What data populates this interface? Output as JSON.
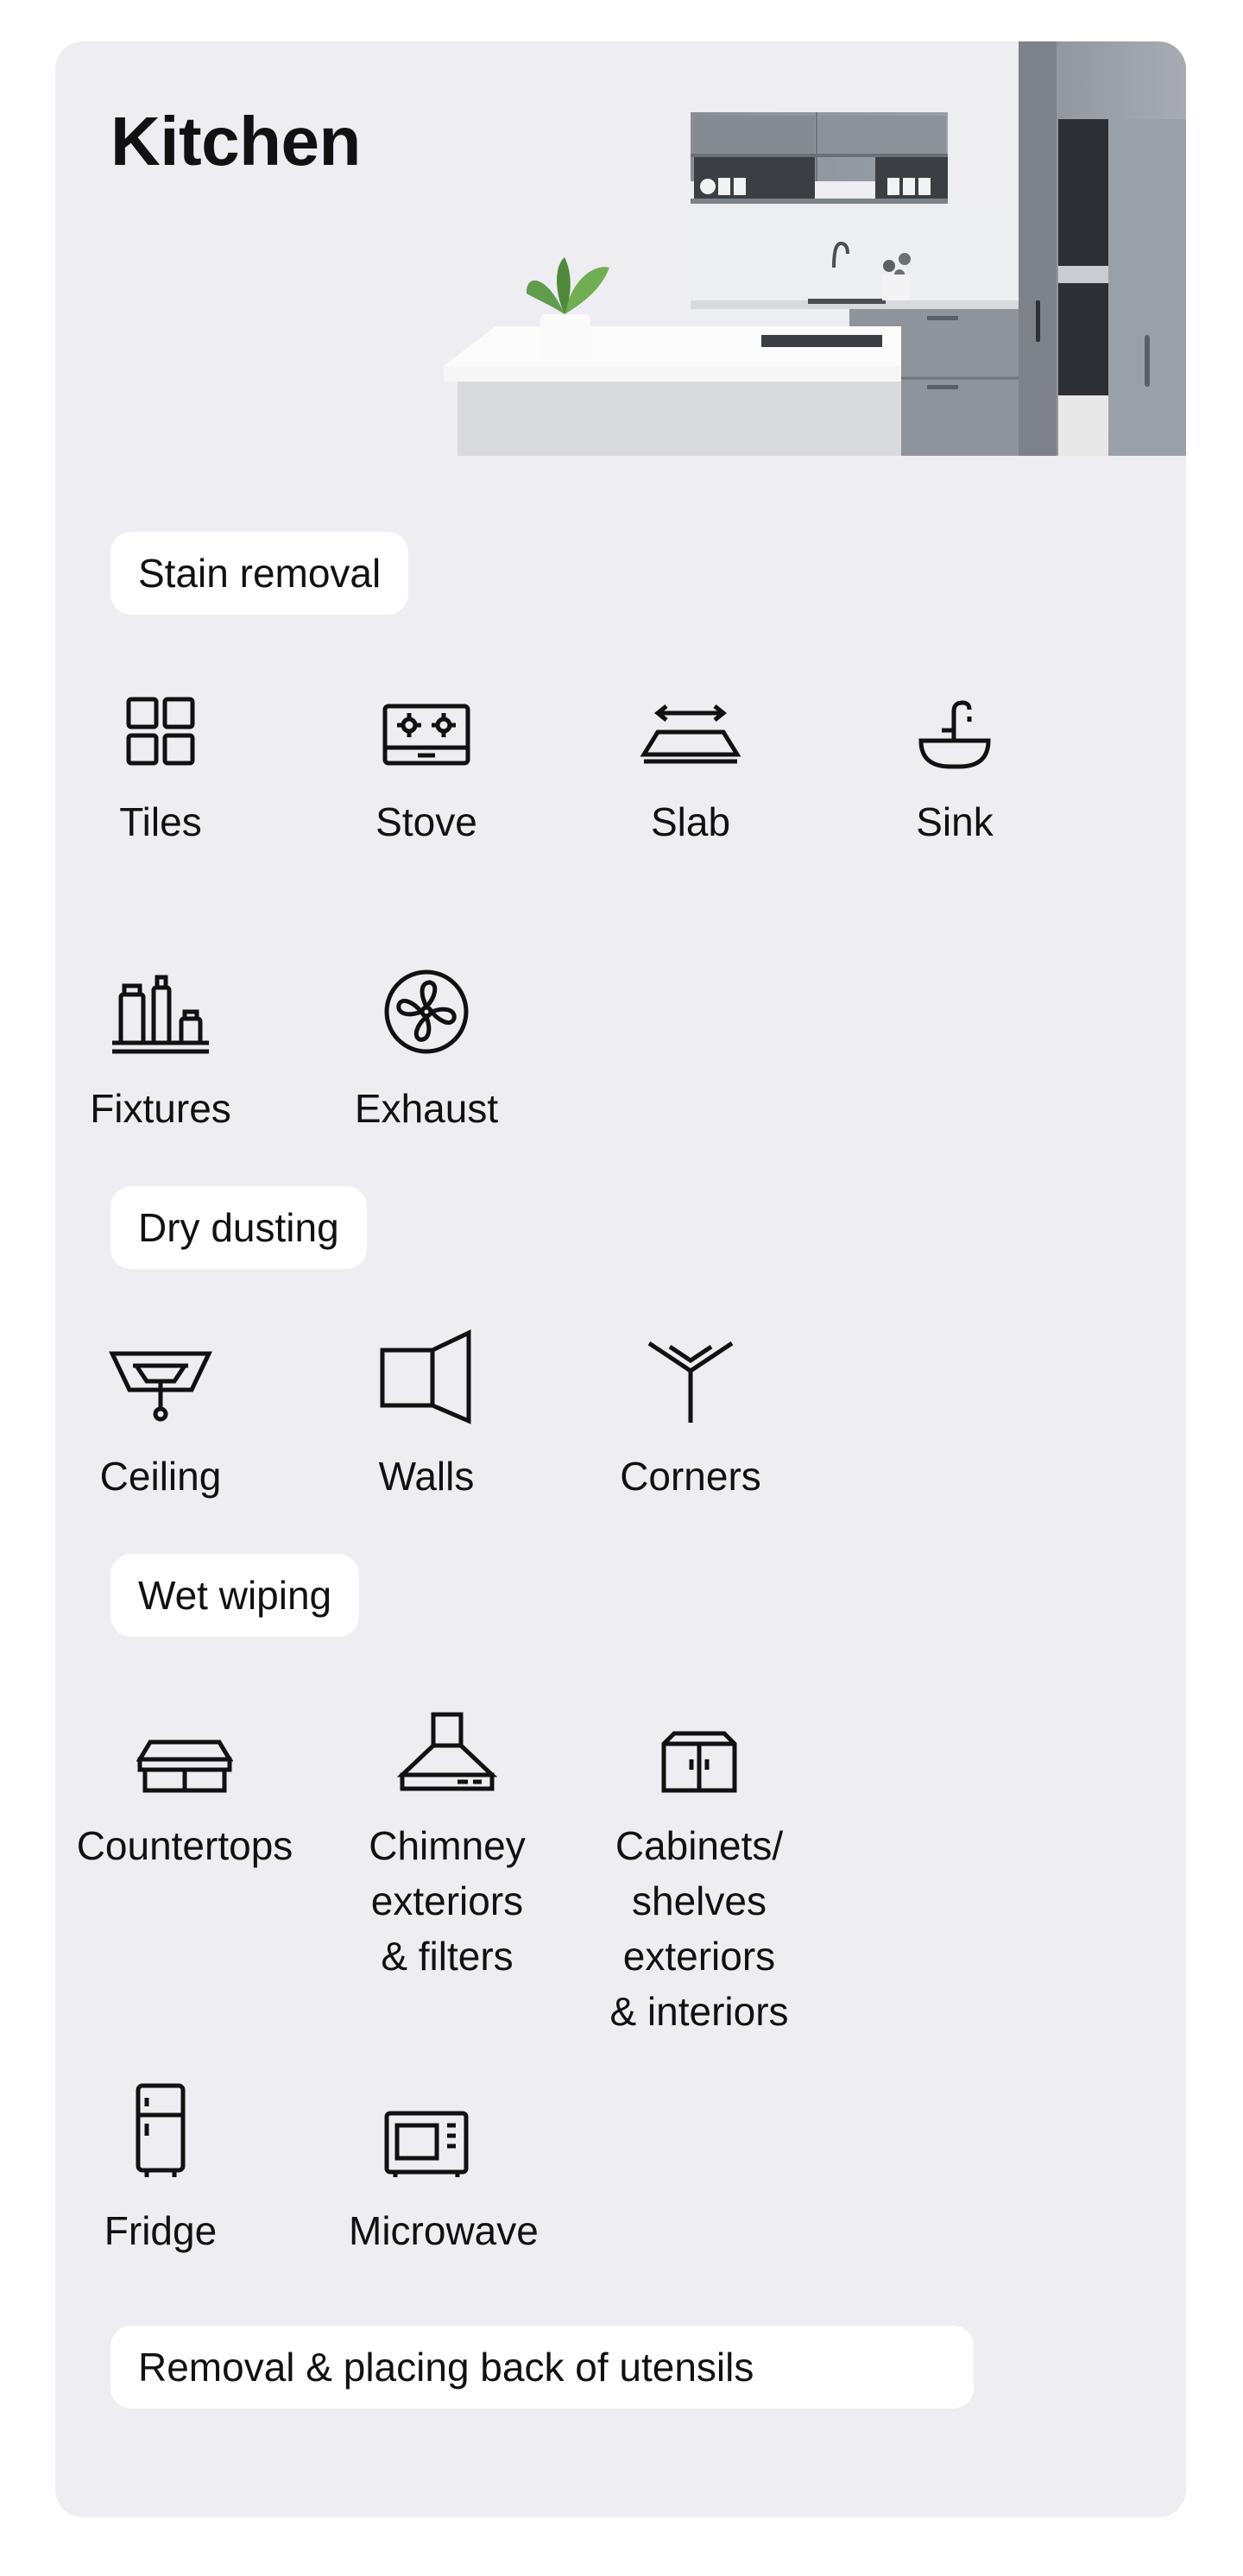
{
  "title": "Kitchen",
  "colors": {
    "card_bg": "#eeeef2",
    "pill_bg": "#ffffff",
    "text": "#111111"
  },
  "sections": [
    {
      "name": "Stain removal",
      "items": [
        {
          "label": "Tiles",
          "icon": "tiles-icon"
        },
        {
          "label": "Stove",
          "icon": "stove-icon"
        },
        {
          "label": "Slab",
          "icon": "slab-icon"
        },
        {
          "label": "Sink",
          "icon": "sink-icon"
        },
        {
          "label": "Fixtures",
          "icon": "fixtures-icon"
        },
        {
          "label": "Exhaust",
          "icon": "exhaust-fan-icon"
        }
      ]
    },
    {
      "name": "Dry dusting",
      "items": [
        {
          "label": "Ceiling",
          "icon": "ceiling-light-icon"
        },
        {
          "label": "Walls",
          "icon": "walls-icon"
        },
        {
          "label": "Corners",
          "icon": "corners-icon"
        }
      ]
    },
    {
      "name": "Wet wiping",
      "items": [
        {
          "label": "Countertops",
          "icon": "countertop-icon"
        },
        {
          "label": "Chimney\nexteriors\n& filters",
          "icon": "chimney-icon"
        },
        {
          "label": "Cabinets/\nshelves\nexteriors\n& interiors",
          "icon": "cabinet-icon"
        },
        {
          "label": "Fridge",
          "icon": "fridge-icon"
        },
        {
          "label": "Microwave",
          "icon": "microwave-icon"
        }
      ]
    },
    {
      "name": "Removal & placing back of utensils",
      "items": []
    }
  ]
}
